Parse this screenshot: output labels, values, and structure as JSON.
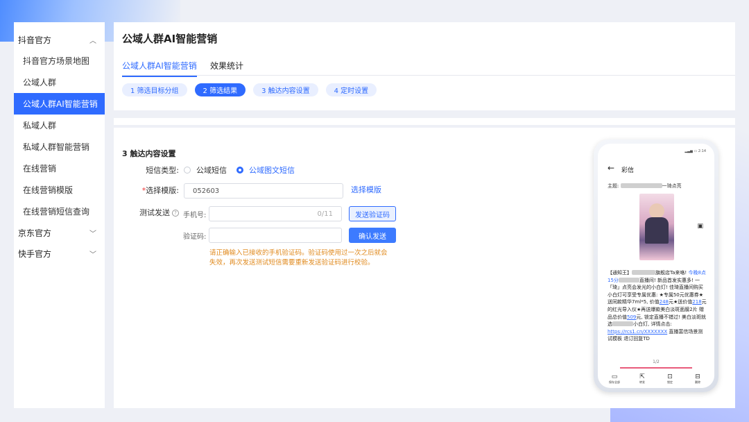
{
  "sidebar": {
    "groups": [
      {
        "label": "抖音官方",
        "chevron": "up"
      },
      {
        "label": "京东官方",
        "chevron": "down"
      },
      {
        "label": "快手官方",
        "chevron": "down"
      }
    ],
    "items": [
      "抖音官方场景地图",
      "公域人群",
      "公域人群AI智能营销",
      "私域人群",
      "私域人群智能营销",
      "在线营销",
      "在线营销模版",
      "在线营销短信查询"
    ],
    "active_item": "公域人群AI智能营销"
  },
  "header": {
    "title": "公域人群AI智能营销",
    "tabs": [
      "公域人群AI智能营销",
      "效果统计"
    ],
    "steps": [
      "1 筛选目标分组",
      "2 筛选结果",
      "3 触达内容设置",
      "4 定时设置"
    ],
    "active_step": "2 筛选结果"
  },
  "form": {
    "section_title": "3 触达内容设置",
    "sms_type_label": "短信类型:",
    "sms_type_options": [
      "公域短信",
      "公域图文短信"
    ],
    "sms_type_selected": "公域图文短信",
    "template_label": "选择模版:",
    "template_required_mark": "*",
    "template_value": "052603",
    "template_link": "选择模版",
    "test_send_label": "测试发送",
    "help_icon": "?",
    "phone_label": "手机号:",
    "phone_counter": "0/11",
    "send_code_button": "发送验证码",
    "code_label": "验证码:",
    "confirm_button": "确认发送",
    "hint": "请正确输入已接收的手机验证码。验证码使用过一次之后就会失效，再次发送测试短信需要重新发送验证码进行校验。"
  },
  "phone_preview": {
    "status": "▂▃▅ ▭ 2:14",
    "back_icon": "←",
    "title": "彩信",
    "subject_label": "主题:",
    "subject_suffix": "一琦点亮",
    "body_1": "【通知王】",
    "body_2": "旗舰店Ta来咯! ",
    "body_link_1": "今晚8点15分",
    "body_3": "直播间! 新品首发实惠多! 一「琦」点亮会发光的小白灯! 佳琦直播间购买小白灯可享受专属优惠: ★专属50元优惠券★送同款精华7ml*5, 价值",
    "body_num_1": "248",
    "body_4": "元★送价值",
    "body_num_2": "218",
    "body_5": "元的红光导入仪★再送爆款美白淡斑面膜2片 赠品总价值",
    "body_num_3": "509",
    "body_6": "元, 锁定直播不错过! 美白淡斑就选",
    "body_7": "小白灯, 详情点击: ",
    "body_url": "https://rcs1.cn/XXXXXXX",
    "body_8": " 直播富信场景测试模板 退订回复TD",
    "page_indicator": "1/2",
    "actions": [
      {
        "icon": "save-icon",
        "glyph": "▭",
        "label": "保存全部"
      },
      {
        "icon": "share-icon",
        "glyph": "⇱",
        "label": "转发"
      },
      {
        "icon": "lock-icon",
        "glyph": "⊡",
        "label": "锁定"
      },
      {
        "icon": "trash-icon",
        "glyph": "⊟",
        "label": "删除"
      }
    ]
  },
  "colors": {
    "accent": "#2f6bff",
    "hint": "#e08a1e",
    "required": "#e33333"
  }
}
